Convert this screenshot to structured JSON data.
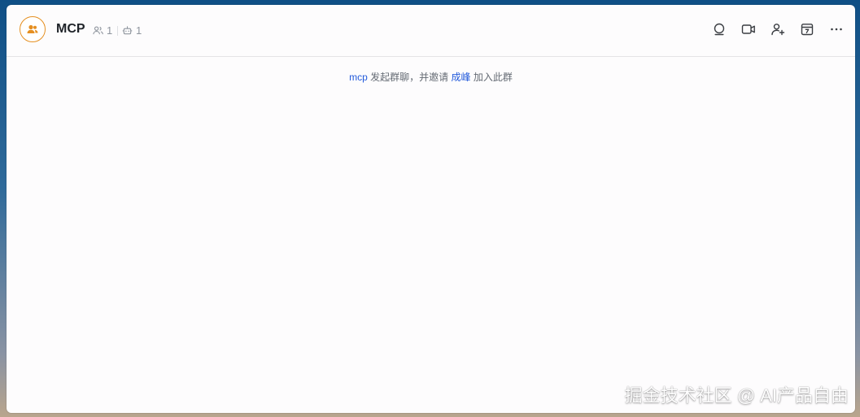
{
  "chat": {
    "title": "MCP",
    "member_count": "1",
    "bot_count": "1",
    "accent_color": "#e58f21"
  },
  "header_actions": [
    {
      "icon": "search-icon"
    },
    {
      "icon": "video-call-icon"
    },
    {
      "icon": "add-member-icon"
    },
    {
      "icon": "calendar-icon"
    },
    {
      "icon": "more-icon"
    }
  ],
  "system_message": {
    "initiator": "mcp",
    "text_1": "发起群聊，并邀请",
    "invitee": "成峰",
    "text_2": "加入此群"
  },
  "watermark": "掘金技术社区 @ AI产品自由"
}
